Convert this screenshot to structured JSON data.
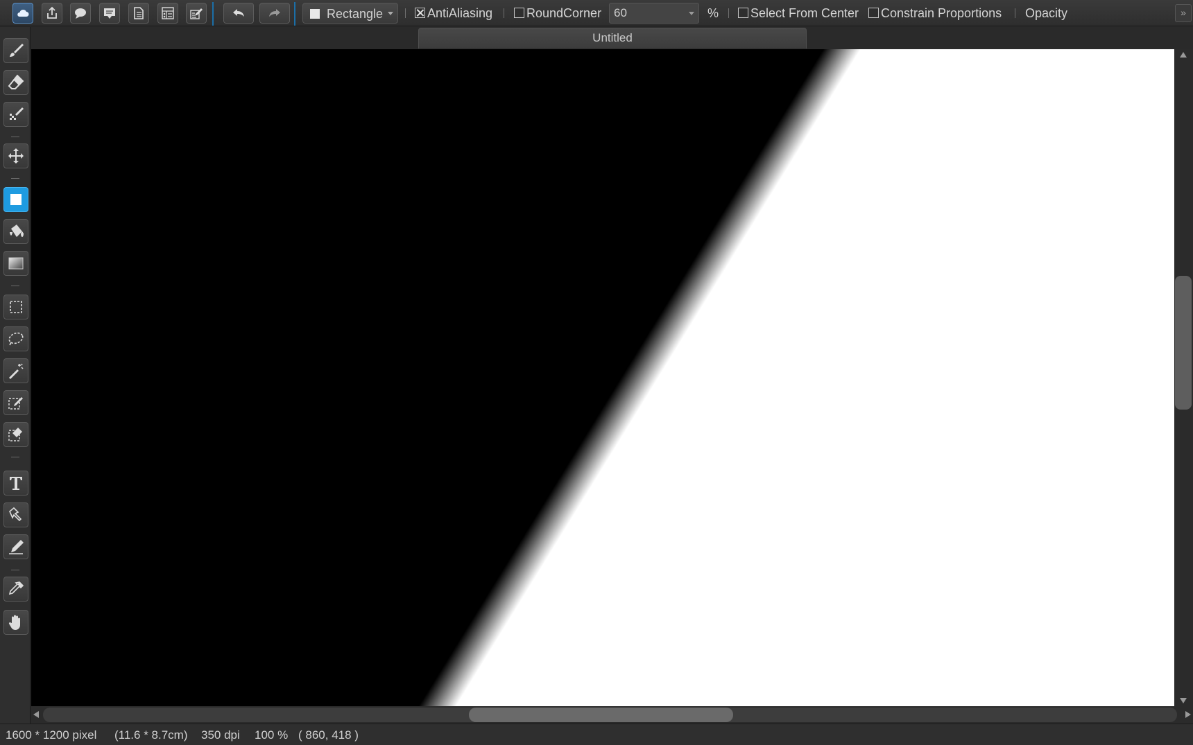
{
  "toolbar": {
    "buttons": [
      {
        "name": "cloud-icon"
      },
      {
        "name": "share-icon"
      },
      {
        "name": "chat-bubble-icon"
      },
      {
        "name": "comment-icon"
      },
      {
        "name": "document-icon"
      },
      {
        "name": "list-panel-icon"
      },
      {
        "name": "edit-panel-icon"
      }
    ],
    "undo_icon": "undo-icon",
    "redo_icon": "redo-icon",
    "shape_label": "Rectangle",
    "antialiasing_label": "AntiAliasing",
    "antialiasing_checked": true,
    "roundcorner_label": "RoundCorner",
    "roundcorner_checked": false,
    "roundcorner_value": "60",
    "unit_label": "%",
    "select_from_center_label": "Select From Center",
    "select_from_center_checked": false,
    "constrain_label": "Constrain Proportions",
    "constrain_checked": false,
    "opacity_label": "Opacity",
    "accent_color": "#1e9be0"
  },
  "tools": [
    {
      "name": "brush-tool-icon"
    },
    {
      "name": "eraser-tool-icon"
    },
    {
      "name": "pixel-brush-tool-icon"
    },
    {
      "name": "move-tool-icon"
    },
    {
      "name": "rectangle-shape-tool-icon",
      "active": true
    },
    {
      "name": "paint-bucket-tool-icon"
    },
    {
      "name": "gradient-tool-icon"
    },
    {
      "name": "rect-select-tool-icon"
    },
    {
      "name": "lasso-select-tool-icon"
    },
    {
      "name": "magic-wand-tool-icon"
    },
    {
      "name": "select-pen-tool-icon"
    },
    {
      "name": "select-eraser-tool-icon"
    },
    {
      "name": "text-tool-icon"
    },
    {
      "name": "transform-tool-icon"
    },
    {
      "name": "correction-pen-tool-icon"
    },
    {
      "name": "eyedropper-tool-icon"
    },
    {
      "name": "hand-tool-icon"
    }
  ],
  "document": {
    "title": "Untitled"
  },
  "canvas": {
    "description_colors": {
      "dark": "#000000",
      "light": "#ffffff"
    }
  },
  "statusbar": {
    "size": "1600 * 1200 pixel",
    "physical": "(11.6 * 8.7cm)",
    "dpi": "350 dpi",
    "zoom": "100 %",
    "coords": "( 860, 418 )"
  }
}
